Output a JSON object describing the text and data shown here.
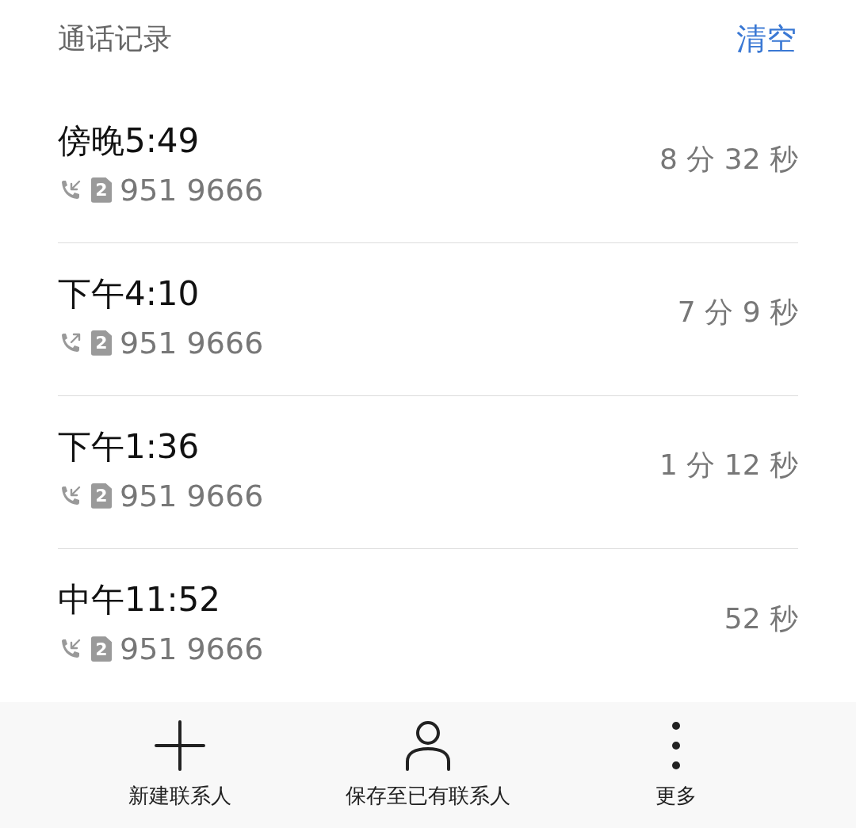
{
  "header": {
    "title": "通话记录",
    "clear_action": "清空"
  },
  "calls": [
    {
      "time": "傍晚5:49",
      "kind": "incoming",
      "sim": "2",
      "number": "951 9666",
      "duration": "8 分 32 秒"
    },
    {
      "time": "下午4:10",
      "kind": "outgoing",
      "sim": "2",
      "number": "951 9666",
      "duration": "7 分 9 秒"
    },
    {
      "time": "下午1:36",
      "kind": "incoming",
      "sim": "2",
      "number": "951 9666",
      "duration": "1 分 12 秒"
    },
    {
      "time": "中午11:52",
      "kind": "incoming",
      "sim": "2",
      "number": "951 9666",
      "duration": "52 秒"
    }
  ],
  "bottom_bar": [
    {
      "kind": "add",
      "label": "新建联系人"
    },
    {
      "kind": "person",
      "label": "保存至已有联系人"
    },
    {
      "kind": "more",
      "label": "更多"
    }
  ]
}
